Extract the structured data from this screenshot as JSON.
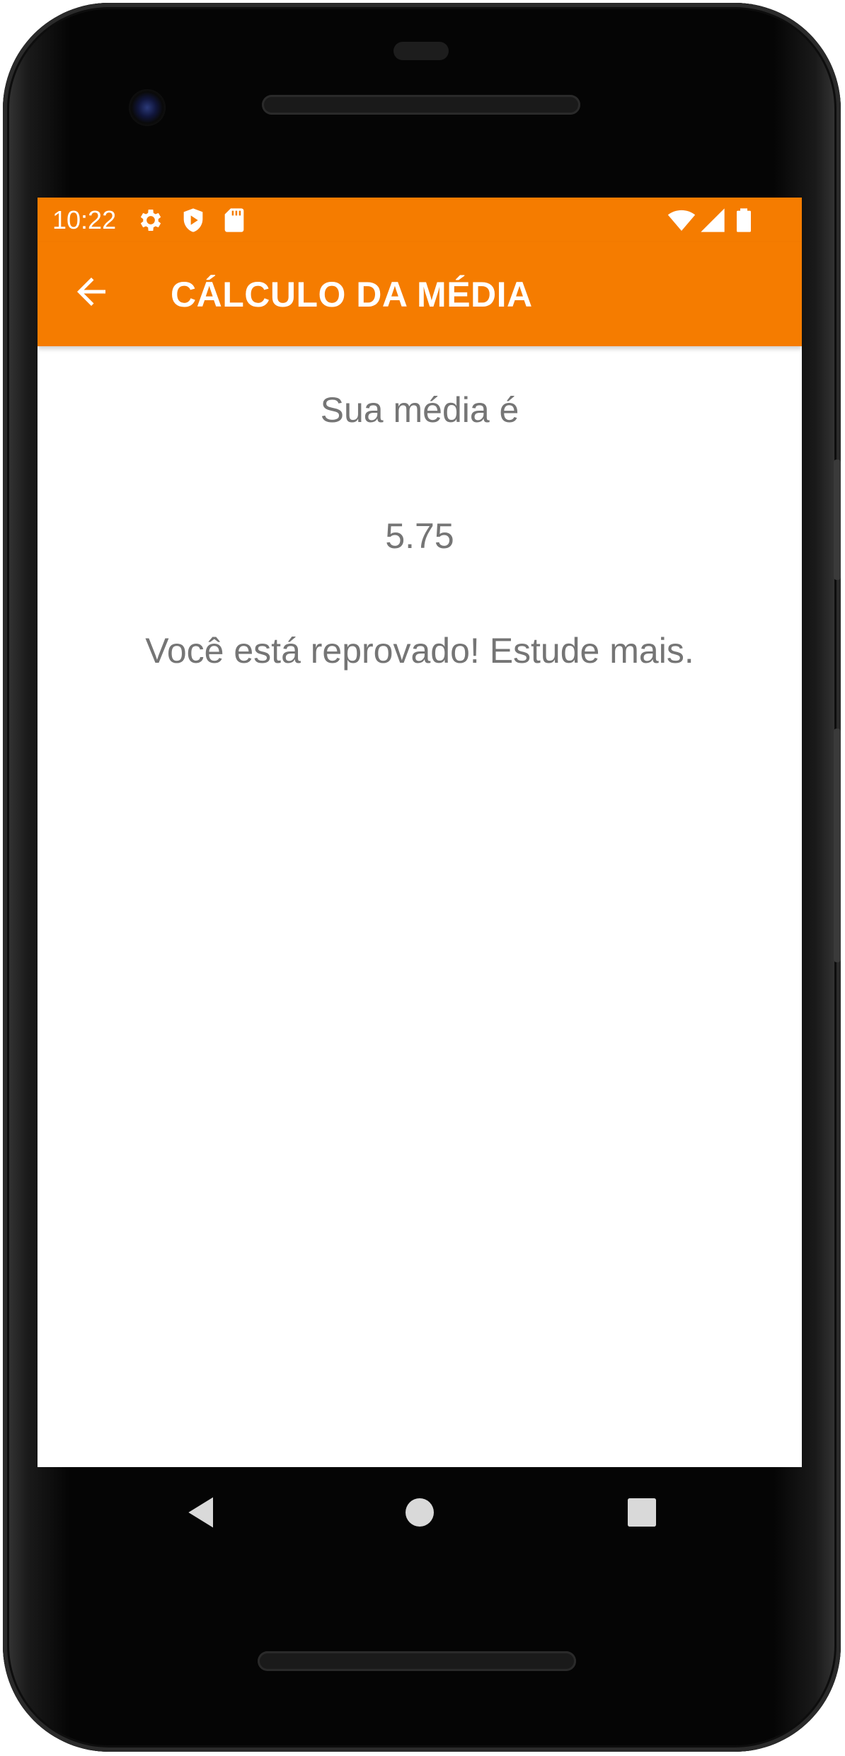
{
  "status_bar": {
    "time": "10:22",
    "left_icons": [
      "gear-icon",
      "shield-play-icon",
      "sd-card-icon"
    ],
    "right_icons": [
      "wifi-icon",
      "signal-icon",
      "battery-icon"
    ]
  },
  "app_bar": {
    "title": "CÁLCULO DA MÉDIA",
    "back_icon": "arrow-left-icon",
    "color": "#f57c00"
  },
  "content": {
    "label": "Sua média é",
    "average": "5.75",
    "message": "Você está reprovado! Estude mais.",
    "text_color": "#757575"
  },
  "nav_bar": {
    "icons": [
      "triangle-back-icon",
      "circle-home-icon",
      "square-recents-icon"
    ]
  }
}
